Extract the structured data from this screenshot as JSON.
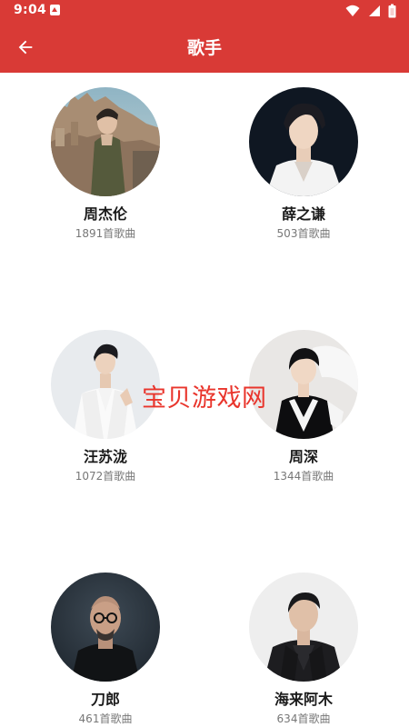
{
  "status_bar": {
    "time": "9:04",
    "icons": [
      "notification-icon",
      "wifi-icon",
      "signal-icon",
      "battery-icon"
    ]
  },
  "toolbar": {
    "title": "歌手",
    "back_icon": "arrow-left-icon",
    "background": "#d93a36"
  },
  "singers": [
    {
      "name": "周杰伦",
      "count": "1891首歌曲"
    },
    {
      "name": "薛之谦",
      "count": "503首歌曲"
    },
    {
      "name": "汪苏泷",
      "count": "1072首歌曲"
    },
    {
      "name": "周深",
      "count": "1344首歌曲"
    },
    {
      "name": "刀郎",
      "count": "461首歌曲"
    },
    {
      "name": "海来阿木",
      "count": "634首歌曲"
    }
  ],
  "watermark": {
    "text": "宝贝游戏网",
    "color": "#e9352c"
  }
}
